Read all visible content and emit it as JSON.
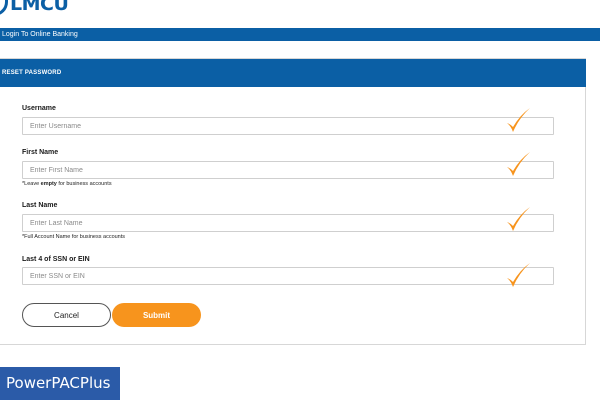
{
  "brand": {
    "logo_text": "LMCU",
    "accent": "#0b5fa5",
    "button_accent": "#f7941d",
    "check_color": "#f7941d"
  },
  "topbar": {
    "title": "Login To Online Banking"
  },
  "panel": {
    "title": "RESET PASSWORD"
  },
  "form": {
    "username": {
      "label": "Username",
      "placeholder": "Enter Username",
      "valid_icon": "checkmark-icon"
    },
    "first_name": {
      "label": "First Name",
      "placeholder": "Enter First Name",
      "hint_prefix": "*Leave ",
      "hint_bold": "empty",
      "hint_suffix": " for business accounts",
      "valid_icon": "checkmark-icon"
    },
    "last_name": {
      "label": "Last Name",
      "placeholder": "Enter Last Name",
      "hint": "*Full Account Name for business accounts",
      "valid_icon": "checkmark-icon"
    },
    "ssn": {
      "label": "Last 4 of SSN or EIN",
      "placeholder": "Enter SSN or EIN",
      "valid_icon": "checkmark-icon"
    }
  },
  "buttons": {
    "cancel_label": "Cancel",
    "submit_label": "Submit"
  },
  "watermark": {
    "text": "PowerPACPlus"
  }
}
